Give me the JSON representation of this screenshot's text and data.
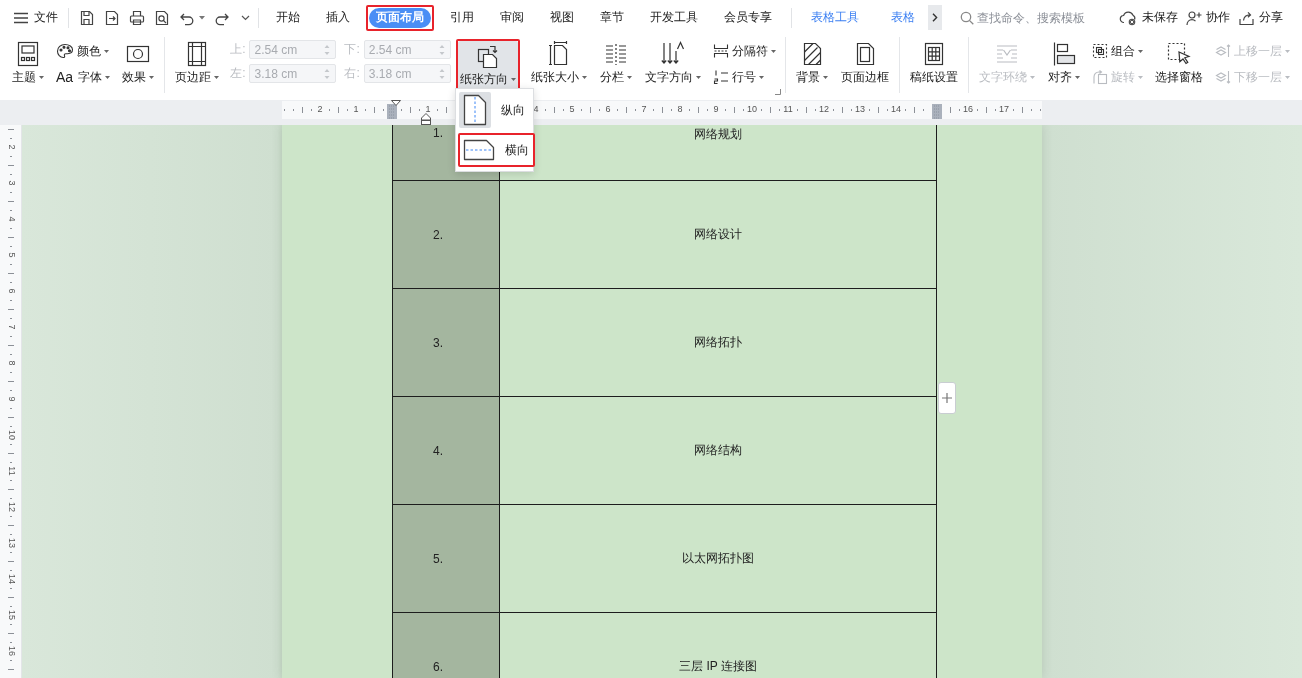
{
  "top_bar": {
    "file_menu": "文件",
    "tabs": [
      {
        "label": "开始",
        "selected": false,
        "highlighted": false
      },
      {
        "label": "插入",
        "selected": false,
        "highlighted": false
      },
      {
        "label": "页面布局",
        "selected": true,
        "highlighted": true
      },
      {
        "label": "引用",
        "selected": false,
        "highlighted": false
      },
      {
        "label": "审阅",
        "selected": false,
        "highlighted": false
      },
      {
        "label": "视图",
        "selected": false,
        "highlighted": false
      },
      {
        "label": "章节",
        "selected": false,
        "highlighted": false
      },
      {
        "label": "开发工具",
        "selected": false,
        "highlighted": false
      },
      {
        "label": "会员专享",
        "selected": false,
        "highlighted": false
      }
    ],
    "context_tabs": [
      {
        "label": "表格工具",
        "selected": false
      },
      {
        "label": "表格",
        "selected": false
      }
    ],
    "search": {
      "placeholder": "查找命令、搜索模板"
    },
    "actions": [
      {
        "kind": "cloud",
        "label": "未保存"
      },
      {
        "kind": "collaborate",
        "label": "协作"
      },
      {
        "kind": "share",
        "label": "分享"
      }
    ]
  },
  "ribbon": {
    "groups": [
      {
        "launcher": false,
        "items": [
          {
            "kind": "large",
            "label": "主题",
            "dropdown": true,
            "disabled": false,
            "pressed": false,
            "highlighted": false
          },
          {
            "kind": "stack",
            "rows": [
              {
                "label": "颜色",
                "dropdown": true,
                "disabled": false
              },
              {
                "glyph": "Aa",
                "label": "字体",
                "dropdown": true,
                "disabled": false
              }
            ]
          },
          {
            "kind": "large",
            "label": "效果",
            "dropdown": true,
            "disabled": false,
            "pressed": false,
            "highlighted": false
          }
        ]
      },
      {
        "launcher": true,
        "items": [
          {
            "kind": "large",
            "label": "页边距",
            "dropdown": true,
            "disabled": false,
            "pressed": false,
            "highlighted": false
          },
          {
            "kind": "fields",
            "fields": [
              {
                "label": "上:",
                "value": "2.54 cm",
                "disabled": true
              },
              {
                "label": "下:",
                "value": "2.54 cm",
                "disabled": true
              },
              {
                "label": "左:",
                "value": "3.18 cm",
                "disabled": true
              },
              {
                "label": "右:",
                "value": "3.18 cm",
                "disabled": true
              }
            ]
          },
          {
            "kind": "large",
            "label": "纸张方向",
            "dropdown": true,
            "disabled": false,
            "pressed": true,
            "highlighted": true
          },
          {
            "kind": "large",
            "label": "纸张大小",
            "dropdown": true,
            "disabled": false,
            "pressed": false,
            "highlighted": false
          },
          {
            "kind": "large",
            "label": "分栏",
            "dropdown": true,
            "disabled": false,
            "pressed": false,
            "highlighted": false
          },
          {
            "kind": "large",
            "label": "文字方向",
            "dropdown": true,
            "disabled": false,
            "pressed": false,
            "highlighted": false
          },
          {
            "kind": "stack",
            "rows": [
              {
                "label": "分隔符",
                "dropdown": true,
                "disabled": false
              },
              {
                "label": "行号",
                "dropdown": true,
                "disabled": false
              }
            ]
          }
        ]
      },
      {
        "launcher": false,
        "items": [
          {
            "kind": "large",
            "label": "背景",
            "dropdown": true,
            "disabled": false,
            "pressed": false,
            "highlighted": false
          },
          {
            "kind": "large",
            "label": "页面边框",
            "dropdown": false,
            "disabled": false,
            "pressed": false,
            "highlighted": false
          }
        ]
      },
      {
        "launcher": false,
        "items": [
          {
            "kind": "large",
            "label": "稿纸设置",
            "dropdown": false,
            "disabled": false,
            "pressed": false,
            "highlighted": false
          }
        ]
      },
      {
        "launcher": false,
        "items": [
          {
            "kind": "large",
            "label": "文字环绕",
            "dropdown": true,
            "disabled": true,
            "pressed": false,
            "highlighted": false
          },
          {
            "kind": "large",
            "label": "对齐",
            "dropdown": true,
            "disabled": false,
            "pressed": false,
            "highlighted": false
          },
          {
            "kind": "stack",
            "rows": [
              {
                "label": "组合",
                "dropdown": true,
                "disabled": false
              },
              {
                "label": "旋转",
                "dropdown": true,
                "disabled": true
              }
            ]
          },
          {
            "kind": "large",
            "label": "选择窗格",
            "dropdown": false,
            "disabled": false,
            "pressed": false,
            "highlighted": false
          },
          {
            "kind": "stack",
            "rows": [
              {
                "label": "上移一层",
                "dropdown": true,
                "disabled": true
              },
              {
                "label": "下移一层",
                "dropdown": true,
                "disabled": true
              }
            ]
          }
        ]
      }
    ]
  },
  "orientation_menu": {
    "items": [
      {
        "kind": "portrait",
        "label": "纵向",
        "selected": true,
        "highlighted": false
      },
      {
        "kind": "landscape",
        "label": "横向",
        "selected": false,
        "highlighted": true
      }
    ]
  },
  "ruler": {
    "left_labels": [
      "2",
      "1"
    ],
    "right_labels": [
      "1",
      "4",
      "5",
      "6",
      "7",
      "8",
      "9",
      "10",
      "11",
      "12",
      "13",
      "14",
      "16",
      "17"
    ]
  },
  "vertical_ruler": {
    "labels": [
      "2",
      "3",
      "4",
      "5",
      "6",
      "7",
      "8",
      "9",
      "10",
      "11",
      "12",
      "13",
      "14",
      "15",
      "16"
    ]
  },
  "table": {
    "rows": [
      {
        "number": "1.",
        "title": "网络规划"
      },
      {
        "number": "2.",
        "title": "网络设计"
      },
      {
        "number": "3.",
        "title": "网络拓扑"
      },
      {
        "number": "4.",
        "title": "网络结构"
      },
      {
        "number": "5.",
        "title": "以太网拓扑图"
      },
      {
        "number": "6.",
        "title": "三层 IP 连接图"
      }
    ]
  }
}
